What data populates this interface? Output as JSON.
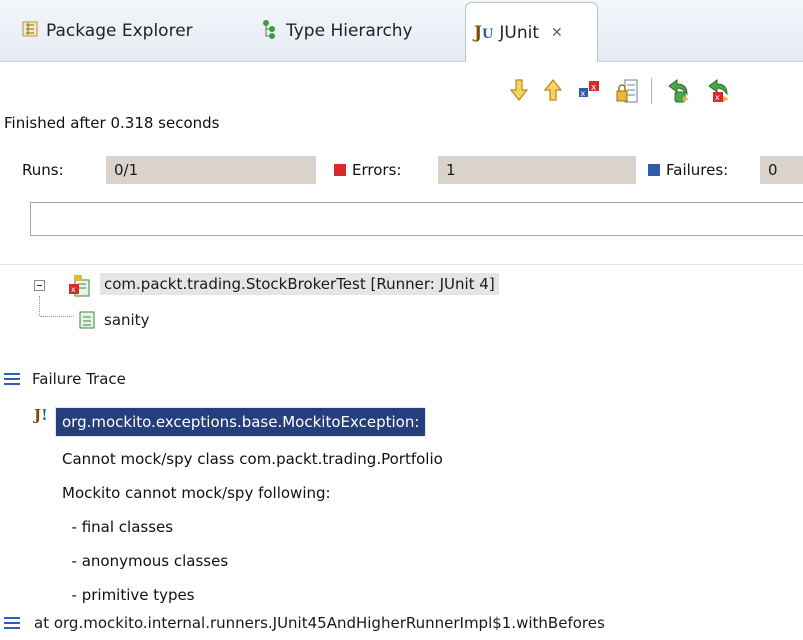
{
  "tabs": [
    {
      "label": "Package Explorer",
      "icon": "package-explorer-icon"
    },
    {
      "label": "Type Hierarchy",
      "icon": "type-hierarchy-icon"
    },
    {
      "label": "JUnit",
      "icon": "junit-icon",
      "active": true,
      "close_icon": "close-icon"
    }
  ],
  "toolbar": {
    "icons": [
      "next-failure-icon",
      "previous-failure-icon",
      "show-failures-only-icon",
      "scroll-lock-icon",
      "rerun-test-icon",
      "rerun-failed-first-icon"
    ]
  },
  "status": {
    "text": "Finished after 0.318 seconds"
  },
  "counters": {
    "runs_label": "Runs:",
    "runs_value": "0/1",
    "errors_label": "Errors:",
    "errors_value": "1",
    "failures_label": "Failures:",
    "failures_value": "0"
  },
  "tree": {
    "root": "com.packt.trading.StockBrokerTest [Runner: JUnit 4]",
    "child": "sanity"
  },
  "failure_trace": {
    "header": "Failure Trace",
    "lines": [
      "org.mockito.exceptions.base.MockitoException:",
      "Cannot mock/spy class com.packt.trading.Portfolio",
      "Mockito cannot mock/spy following:",
      "  - final classes",
      "  - anonymous classes",
      "  - primitive types",
      "at org.mockito.internal.runners.JUnit45AndHigherRunnerImpl$1.withBefores"
    ]
  },
  "colors": {
    "error_red": "#d92a2a",
    "failure_blue": "#2f5da9",
    "selection_bg": "#253f7d",
    "counter_field_bg": "#d9d3cc"
  }
}
